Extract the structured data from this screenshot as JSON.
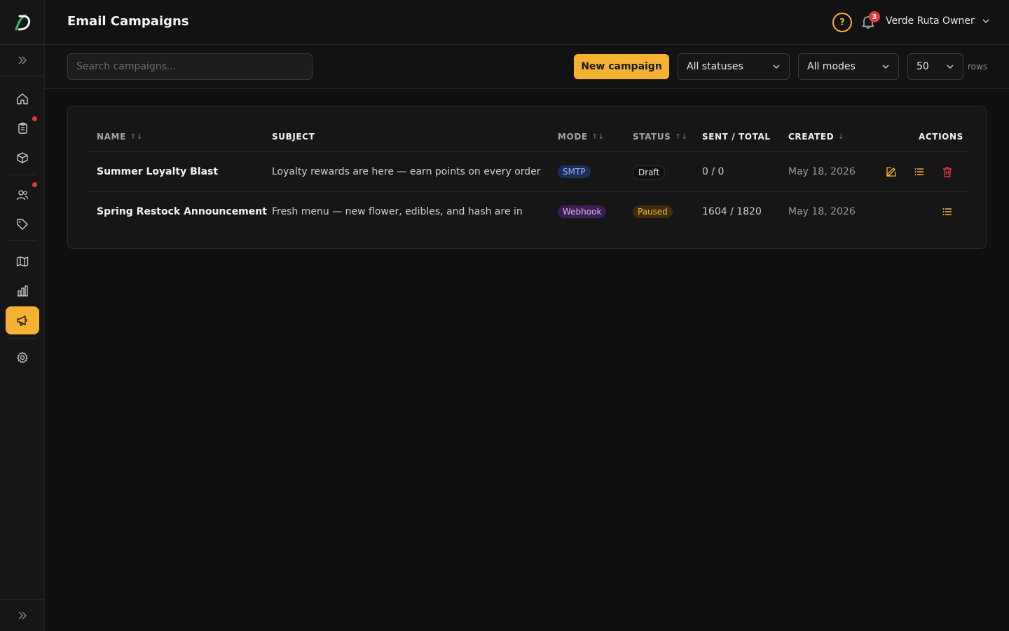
{
  "header": {
    "title": "Email Campaigns",
    "help_label": "?",
    "notification_count": "3",
    "user_name": "Verde Ruta Owner"
  },
  "toolbar": {
    "search_placeholder": "Search campaigns...",
    "new_campaign_label": "New campaign",
    "status_filter": "All statuses",
    "mode_filter": "All modes",
    "rows_value": "50",
    "rows_label": "rows"
  },
  "sidebar": {
    "items": [
      {
        "icon": "home-icon",
        "has_dot": false
      },
      {
        "icon": "clipboard-icon",
        "has_dot": true
      },
      {
        "icon": "box-icon",
        "has_dot": false
      },
      {
        "icon": "users-icon",
        "has_dot": true
      },
      {
        "icon": "tag-icon",
        "has_dot": false
      },
      {
        "icon": "map-icon",
        "has_dot": false
      },
      {
        "icon": "chart-icon",
        "has_dot": false
      },
      {
        "icon": "megaphone-icon",
        "has_dot": false,
        "active": true
      },
      {
        "icon": "gear-icon",
        "has_dot": false
      }
    ]
  },
  "table": {
    "columns": [
      "NAME",
      "SUBJECT",
      "MODE",
      "STATUS",
      "SENT / TOTAL",
      "CREATED",
      "ACTIONS"
    ],
    "sort_indicators": {
      "name": "↑↓",
      "mode": "↑↓",
      "status": "↑↓",
      "created": "↓"
    },
    "rows": [
      {
        "name": "Summer Loyalty Blast",
        "subject": "Loyalty rewards are here — earn points on every order",
        "mode": "SMTP",
        "status": "Draft",
        "sent_total": "0 / 0",
        "created": "May 18, 2026",
        "actions": [
          "edit-icon",
          "list-icon",
          "trash-icon"
        ]
      },
      {
        "name": "Spring Restock Announcement",
        "subject": "Fresh menu — new flower, edibles, and hash are in",
        "mode": "Webhook",
        "status": "Paused",
        "sent_total": "1604 / 1820",
        "created": "May 18, 2026",
        "actions": [
          "list-icon"
        ]
      }
    ]
  },
  "colors": {
    "accent": "#f5b232",
    "danger": "#e5393b",
    "background": "#0f0f10"
  }
}
